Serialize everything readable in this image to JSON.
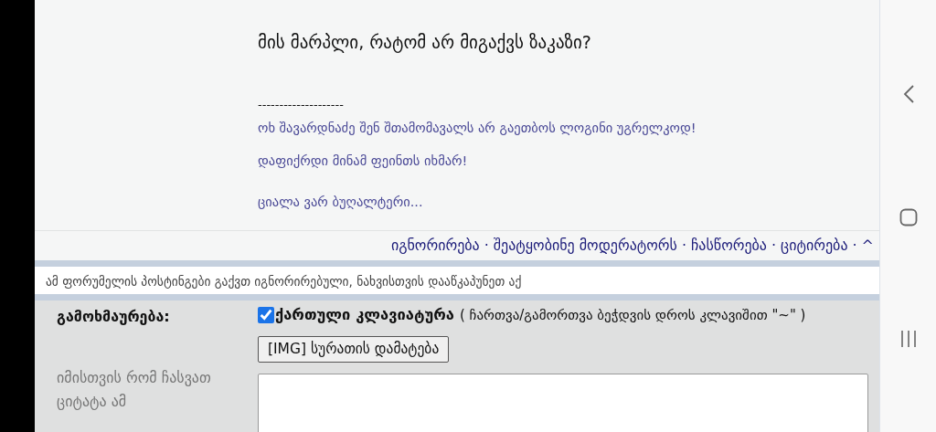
{
  "post": {
    "message": "მის მარპლი, რატომ არ მიგაქვს ზაკაზი?",
    "signature_rule": "--------------------",
    "signature_lines": [
      "ოხ შავარდნაძე შენ შთამომავალს არ გაეთბოს ლოგინი უგრელკოდ!",
      "დაფიქრდი მინამ ფეინთს იხმარ!",
      "ციალა ვარ ბუღალტერი..."
    ]
  },
  "post_actions": {
    "separator": "·",
    "items": [
      {
        "label": "იგნორირება"
      },
      {
        "label": "შეატყობინე მოდერატორს "
      },
      {
        "label": "ჩასწორება"
      },
      {
        "label": "ციტირება"
      },
      {
        "label": "^"
      }
    ]
  },
  "ignored_notice": "ამ ფორუმელის პოსტინგები გაქვთ იგნორირებული, ნახვისთვის დააწკაპუნეთ აქ",
  "reply_form": {
    "field_label": "გამოხმაურება:",
    "keyboard_toggle": {
      "checked": true,
      "label": "ქართული კლავიატურა",
      "hint": "( ჩართვა/გამორთვა ბეჭდვის დროს კლავიშით \"~\" )"
    },
    "img_button": "[IMG] სურათის დამატება",
    "quote_hint": "იმისთვის რომ ჩასვათ ციტატა ამ"
  }
}
